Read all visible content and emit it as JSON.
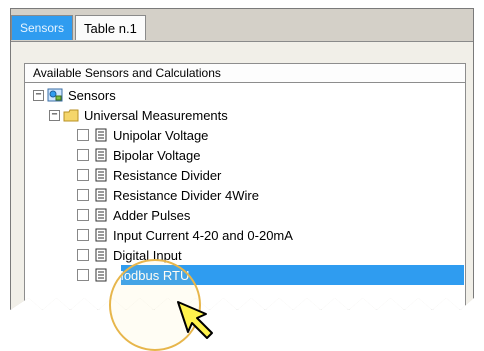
{
  "tabs": {
    "active": "Sensors",
    "inactive": "Table n.1"
  },
  "tree": {
    "header": "Available Sensors and Calculations",
    "root_label": "Sensors",
    "group_label": "Universal Measurements",
    "items": [
      "Unipolar Voltage",
      "Bipolar Voltage",
      "Resistance Divider",
      "Resistance Divider 4Wire",
      "Adder Pulses",
      "Input Current 4-20 and 0-20mA",
      "Digital Input",
      "Modbus RTU"
    ],
    "selected_item": "Modbus RTU",
    "expander_symbol": "−"
  },
  "icons": {
    "root": "sensors-network-icon",
    "group": "folder-icon",
    "item": "document-icon",
    "cursor": "arrow-pointer-icon"
  },
  "colors": {
    "selection": "#2f9cf0",
    "tab_active": "#2f9cf0",
    "highlight_circle": "#e7b64b",
    "cursor_fill": "#fff34d"
  }
}
